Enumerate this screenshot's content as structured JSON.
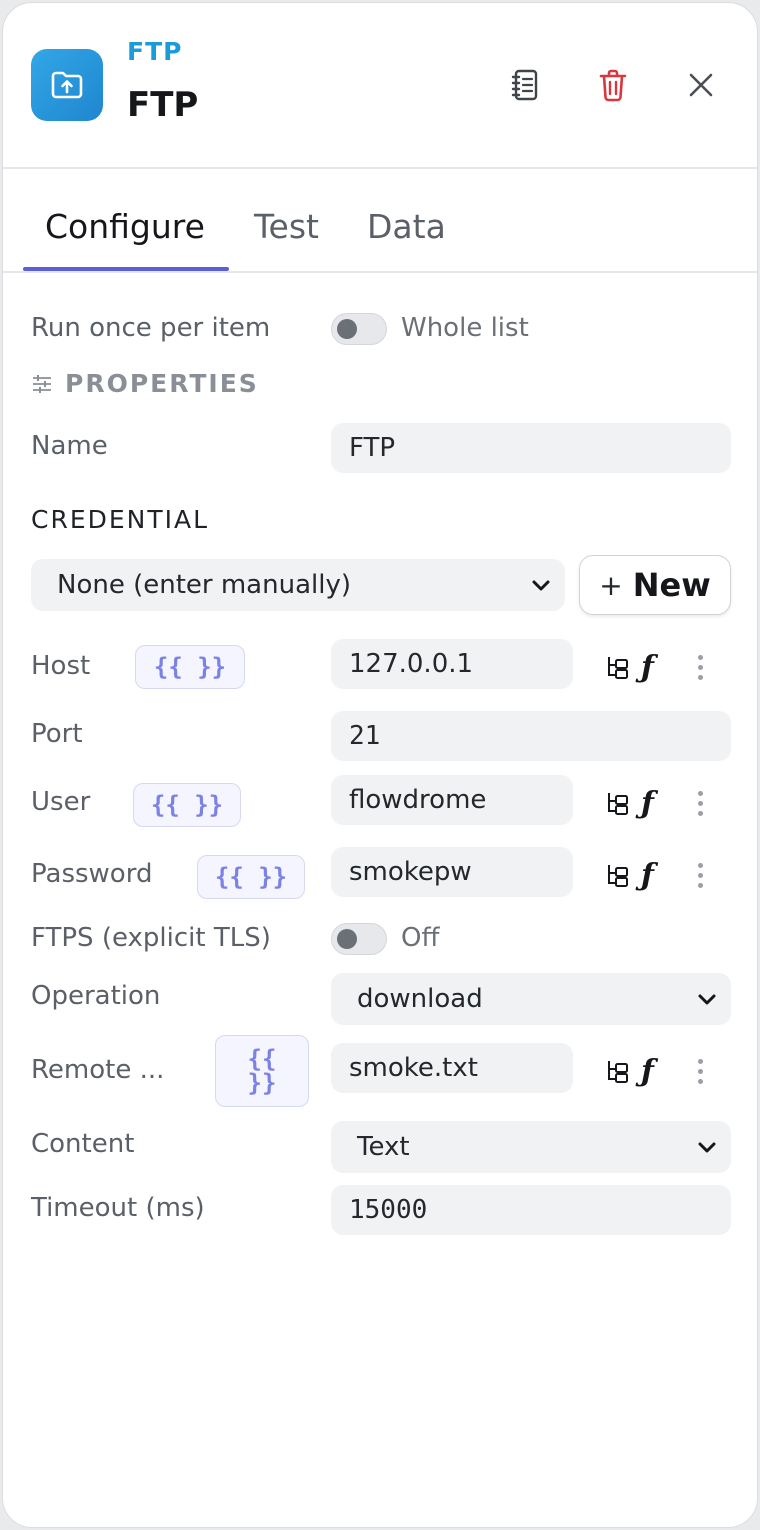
{
  "header": {
    "kind": "FTP",
    "title": "FTP"
  },
  "tabs": [
    {
      "label": "Configure",
      "active": true
    },
    {
      "label": "Test",
      "active": false
    },
    {
      "label": "Data",
      "active": false
    }
  ],
  "run_mode": {
    "label": "Run once per item",
    "toggle_text": "Whole list",
    "on": false
  },
  "properties_heading": "PROPERTIES",
  "name": {
    "label": "Name",
    "value": "FTP"
  },
  "credential": {
    "heading": "CREDENTIAL",
    "selected": "None (enter manually)",
    "new_label": "New",
    "new_plus": "+"
  },
  "host": {
    "label": "Host",
    "template": "{{ }}",
    "value": "127.0.0.1"
  },
  "port": {
    "label": "Port",
    "value": "21"
  },
  "user": {
    "label": "User",
    "template": "{{ }}",
    "value": "flowdrome"
  },
  "password": {
    "label": "Password",
    "template": "{{ }}",
    "value": "smokepw"
  },
  "ftps": {
    "label": "FTPS (explicit TLS)",
    "toggle_text": "Off",
    "on": false
  },
  "operation": {
    "label": "Operation",
    "selected": "download"
  },
  "remote": {
    "label": "Remote ...",
    "template_line1": "{{",
    "template_line2": "}}",
    "value": "smoke.txt"
  },
  "content": {
    "label": "Content",
    "selected": "Text"
  },
  "timeout": {
    "label": "Timeout (ms)",
    "value": "15000"
  },
  "fx_glyph": "ƒ",
  "colors": {
    "accent": "#5b5fd6",
    "brand": "#1b9bd8",
    "danger": "#d9363e",
    "template": "#7c82e4"
  },
  "icons": {
    "app": "folder-upload-icon",
    "notes": "notebook-icon",
    "delete": "trash-icon",
    "close": "close-icon",
    "properties": "sliders-icon",
    "tree": "tree-icon",
    "function": "function-icon",
    "more": "more-vertical-icon",
    "chevron": "chevron-down-icon"
  }
}
